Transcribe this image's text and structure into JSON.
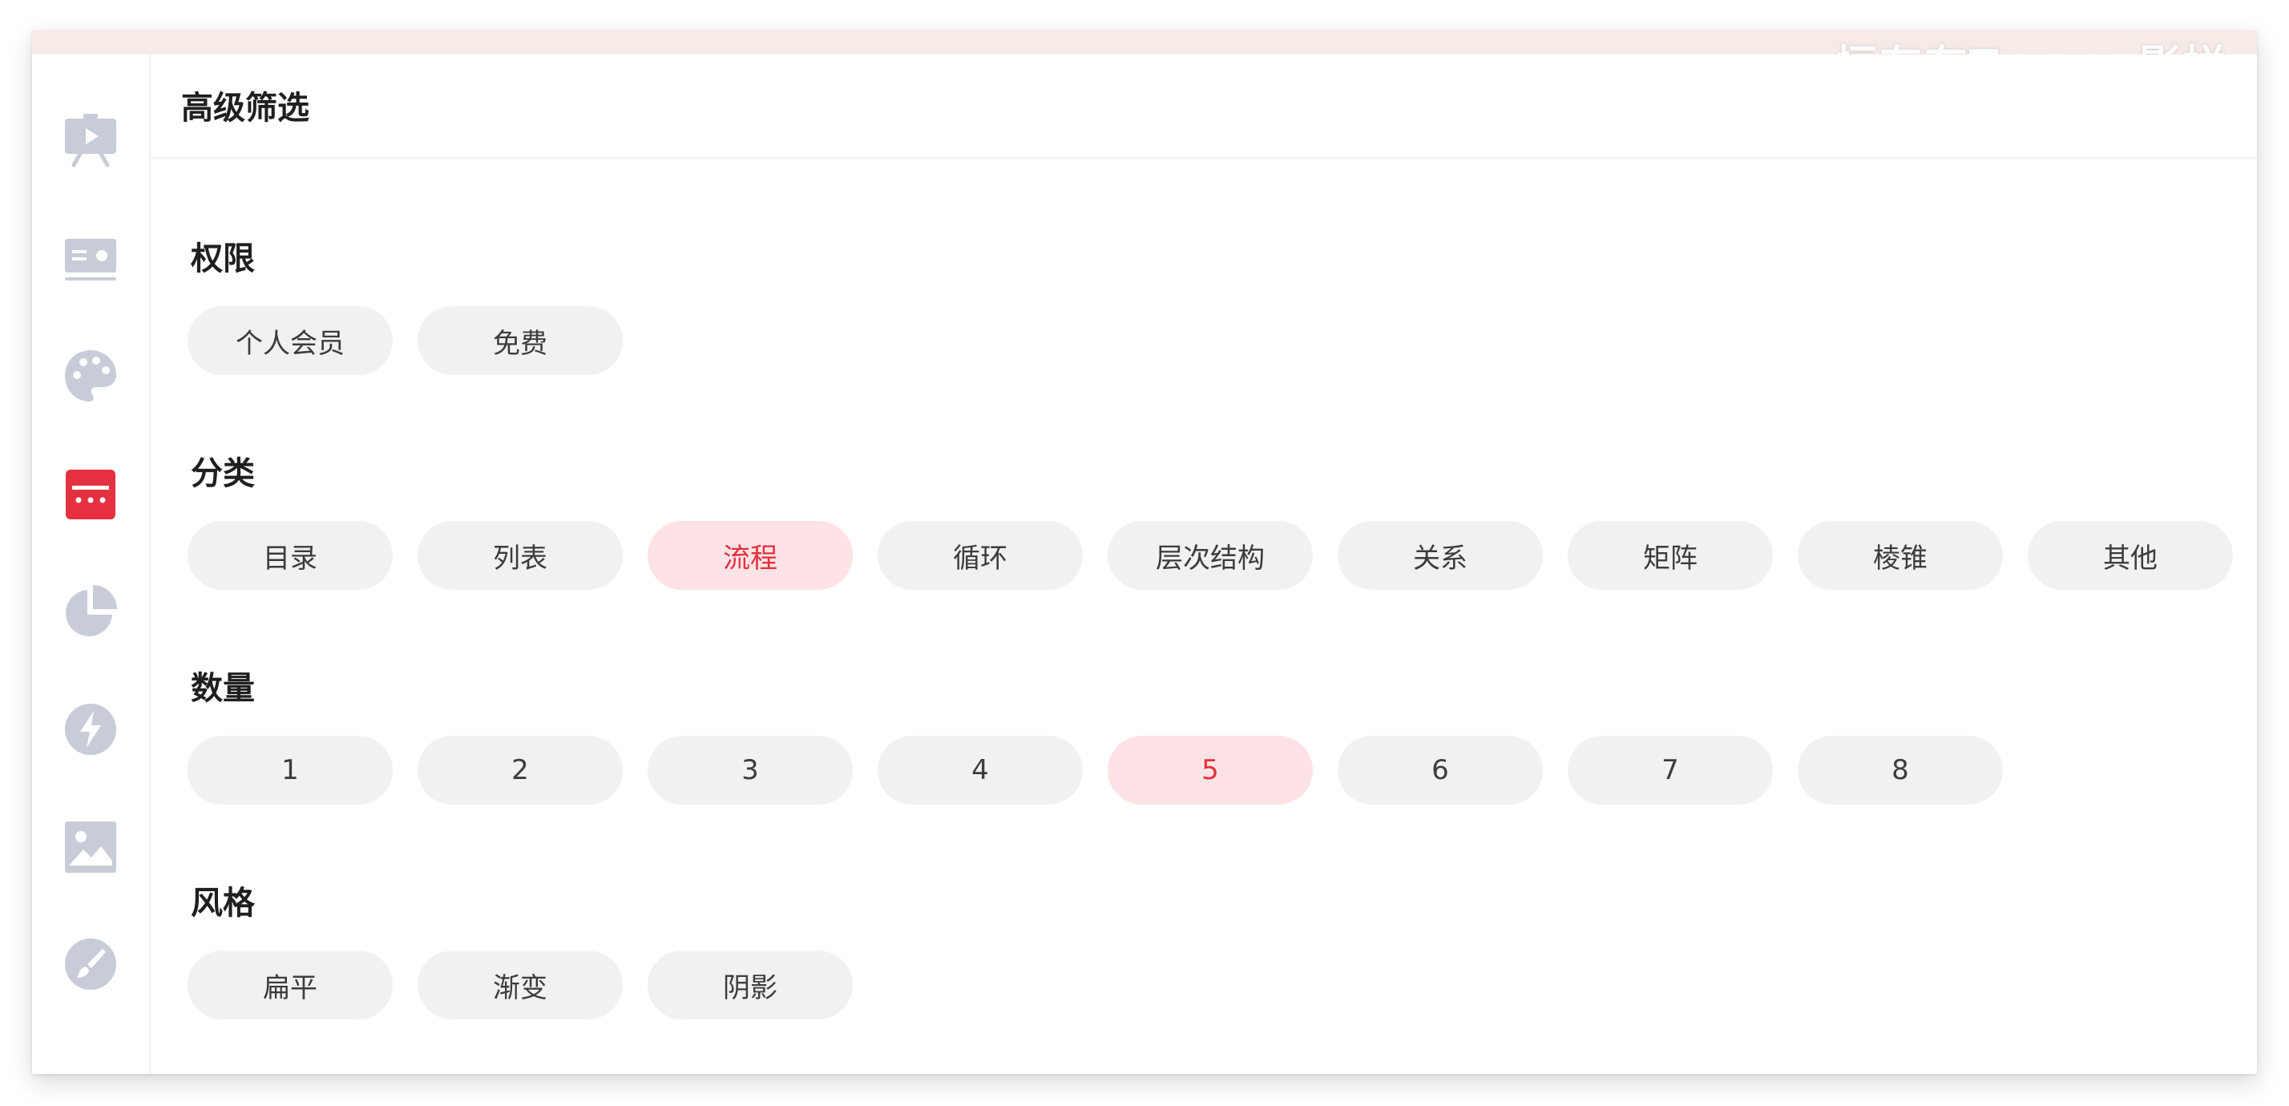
{
  "watermark": "恒存存Tango 影拼",
  "panel": {
    "title": "高级筛选"
  },
  "sidebar": {
    "accent": "#e5303f",
    "inactive_color": "#c8ccd8",
    "items": [
      {
        "icon": "presentation-icon",
        "active": false
      },
      {
        "icon": "card-icon",
        "active": false
      },
      {
        "icon": "palette-icon",
        "active": false
      },
      {
        "icon": "menu-card-icon",
        "active": true
      },
      {
        "icon": "pie-chart-icon",
        "active": false
      },
      {
        "icon": "lightning-icon",
        "active": false
      },
      {
        "icon": "image-icon",
        "active": false
      },
      {
        "icon": "brush-icon",
        "active": false
      }
    ]
  },
  "sections": {
    "permission": {
      "title": "权限",
      "options": [
        "个人会员",
        "免费"
      ],
      "selected": null
    },
    "category": {
      "title": "分类",
      "options": [
        "目录",
        "列表",
        "流程",
        "循环",
        "层次结构",
        "关系",
        "矩阵",
        "棱锥",
        "其他"
      ],
      "selected": "流程"
    },
    "quantity": {
      "title": "数量",
      "options": [
        "1",
        "2",
        "3",
        "4",
        "5",
        "6",
        "7",
        "8"
      ],
      "selected": "5"
    },
    "style": {
      "title": "风格",
      "options": [
        "扁平",
        "渐变",
        "阴影"
      ],
      "selected": null
    }
  },
  "colors": {
    "chip_bg": "#f1f1f1",
    "chip_active_bg": "#fde3e5",
    "chip_active_text": "#e5303f"
  }
}
